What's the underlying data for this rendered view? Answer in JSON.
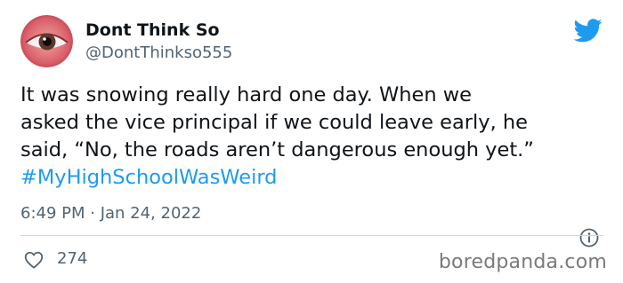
{
  "tweet": {
    "author": {
      "display_name": "Dont Think So",
      "handle": "@DontThinkso555",
      "avatar_icon": "eye-avatar"
    },
    "text_lines": [
      "It was snowing really hard one day. When we",
      "asked the vice principal if we could leave early, he",
      "said, “No, the roads aren’t dangerous enough yet.”"
    ],
    "hashtag": "#MyHighSchoolWasWeird",
    "timestamp": "6:49 PM · Jan 24, 2022",
    "likes": "274"
  },
  "icons": {
    "platform": "twitter-bird-icon",
    "info": "info-icon",
    "like": "heart-icon"
  },
  "watermark": "boredpanda.com",
  "colors": {
    "link": "#1d9bf0",
    "secondary_text": "#536471",
    "primary_text": "#0f1419",
    "divider": "#cfd9de"
  }
}
